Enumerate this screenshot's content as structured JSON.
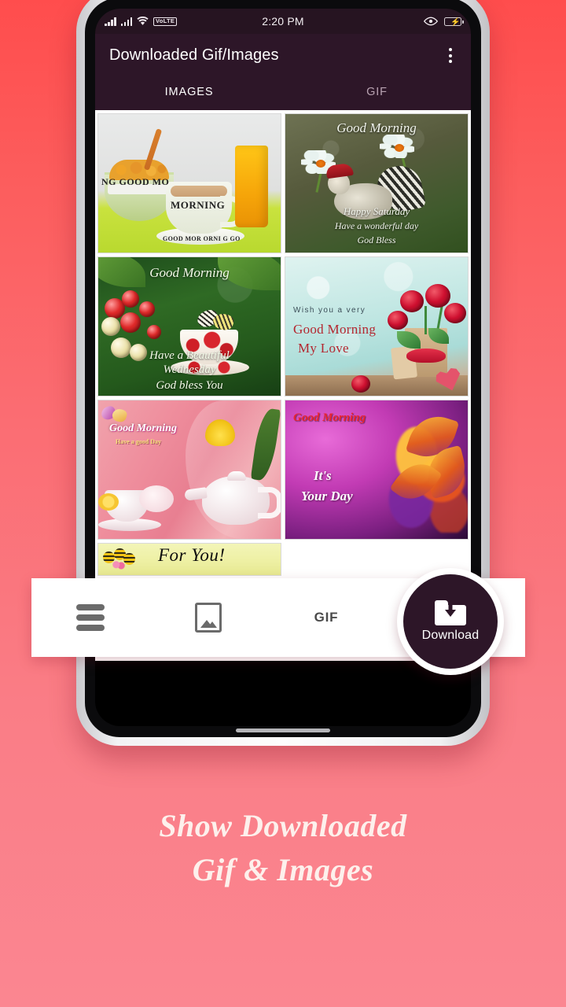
{
  "background": {
    "gradient_top": "#ff4d4d",
    "gradient_bottom": "#fb8691"
  },
  "status_bar": {
    "time": "2:20 PM",
    "network_label": "VoLTE",
    "icons": [
      "signal-bars-icon",
      "signal-bars-icon",
      "wifi-icon",
      "volte-badge",
      "eye-icon",
      "battery-charging-icon"
    ],
    "battery_bolt": "⚡"
  },
  "app_bar": {
    "title": "Downloaded Gif/Images",
    "overflow_icon": "more-vertical-icon",
    "background": "#2d1628"
  },
  "tabs": [
    {
      "label": "IMAGES",
      "active": true
    },
    {
      "label": "GIF",
      "active": false
    }
  ],
  "grid": {
    "tiles": [
      {
        "id": "breakfast",
        "alt": "breakfast with cereal bowl coffee cup and orange juice",
        "texts": [
          "NG GOOD MO",
          "MORNING",
          "GOOD MOR        ORNI G GO"
        ]
      },
      {
        "id": "rooster",
        "alt": "rooster with white daisies on green background",
        "texts": [
          "Good Morning",
          "Happy Saturday",
          "Have a wonderful day",
          "God Bless"
        ]
      },
      {
        "id": "wednesday",
        "alt": "berries teacup and butterfly on green foliage",
        "texts": [
          "Good Morning",
          "Have a Beautiful",
          "Wednesday",
          "God bless You"
        ]
      },
      {
        "id": "mylove",
        "alt": "red roses in paper bag on teal bokeh hearts background",
        "texts": [
          "Wish you a very",
          "Good Morning",
          "My Love"
        ]
      },
      {
        "id": "teapot",
        "alt": "white teapot and cup with yellow tulip on pink background",
        "texts": [
          "Good Morning",
          "Have a good Day"
        ]
      },
      {
        "id": "yourday",
        "alt": "colorful lily on purple magenta background",
        "texts": [
          "Good Morning",
          "It's",
          "Your Day"
        ]
      },
      {
        "id": "foryou",
        "alt": "bees with flowers on yellow background",
        "texts": [
          "For You!"
        ]
      }
    ]
  },
  "bottom_bar": {
    "items": [
      {
        "name": "menu",
        "icon": "hamburger-menu-icon",
        "label": ""
      },
      {
        "name": "images",
        "icon": "image-icon",
        "label": ""
      },
      {
        "name": "gif",
        "icon": "gif-text-icon",
        "label": "GIF"
      }
    ],
    "fab": {
      "label": "Download",
      "icon": "folder-download-icon",
      "color": "#2d1628"
    }
  },
  "caption": {
    "line1": "Show Downloaded",
    "line2": "Gif & Images"
  }
}
